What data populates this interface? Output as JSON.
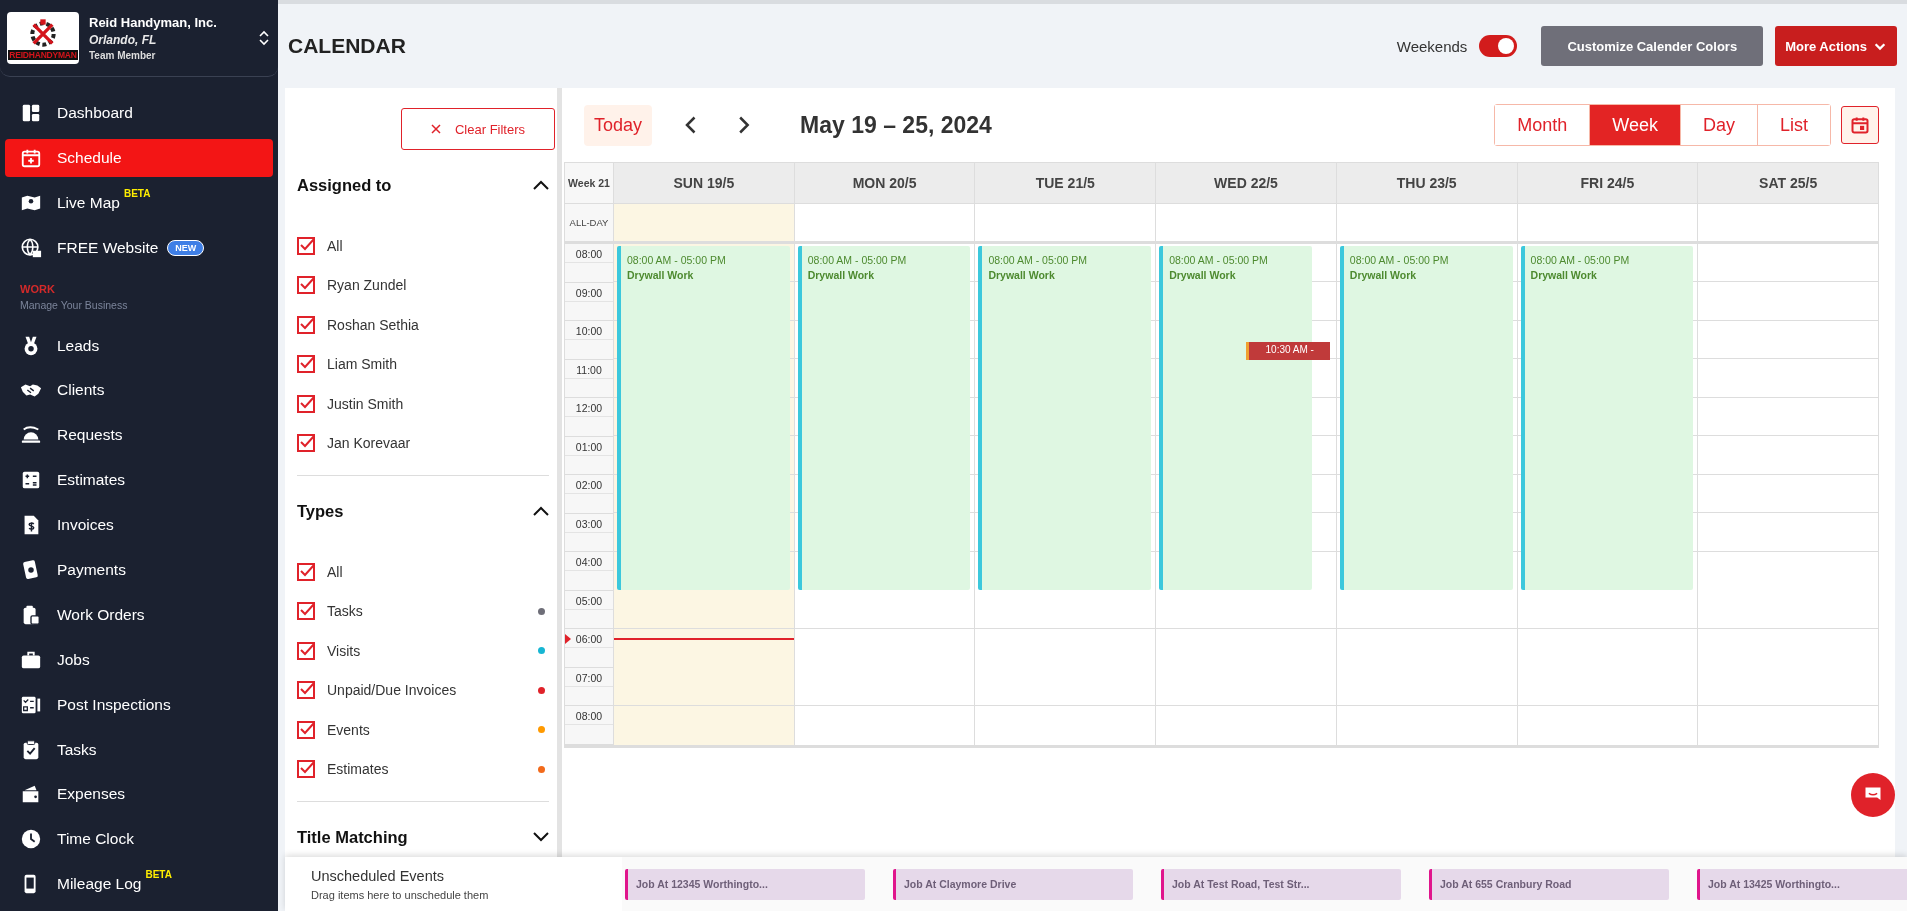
{
  "company": {
    "name": "Reid Handyman, Inc.",
    "location": "Orlando, FL",
    "role": "Team Member",
    "logo_text": "REIDHANDYMAN"
  },
  "sidebar": {
    "items": [
      {
        "label": "Dashboard",
        "selected": false
      },
      {
        "label": "Schedule",
        "selected": true
      },
      {
        "label": "Live Map",
        "selected": false,
        "badge": {
          "text": "BETA",
          "kind": "superscript"
        }
      },
      {
        "label": "FREE Website",
        "selected": false,
        "badge": {
          "text": "NEW",
          "kind": "pill"
        }
      }
    ],
    "section": {
      "title": "WORK",
      "subtitle": "Manage Your Business"
    },
    "work_items": [
      {
        "label": "Leads",
        "selected": false
      },
      {
        "label": "Clients",
        "selected": false
      },
      {
        "label": "Requests",
        "selected": false
      },
      {
        "label": "Estimates",
        "selected": false
      },
      {
        "label": "Invoices",
        "selected": false
      },
      {
        "label": "Payments",
        "selected": false
      },
      {
        "label": "Work Orders",
        "selected": false
      },
      {
        "label": "Jobs",
        "selected": false
      },
      {
        "label": "Post Inspections",
        "selected": false
      },
      {
        "label": "Tasks",
        "selected": false
      },
      {
        "label": "Expenses",
        "selected": false
      },
      {
        "label": "Time Clock",
        "selected": false
      },
      {
        "label": "Mileage Log",
        "selected": false,
        "badge": {
          "text": "BETA",
          "kind": "superscript"
        }
      }
    ]
  },
  "page": {
    "title": "CALENDAR",
    "weekends": {
      "label": "Weekends",
      "on": true
    },
    "buttons": [
      {
        "label": "Customize Calender Colors",
        "kind": "secondary"
      },
      {
        "label": "More Actions",
        "kind": "primary"
      }
    ]
  },
  "filters": {
    "clear": "Clear Filters",
    "sections": [
      {
        "title": "Assigned to",
        "expanded": true,
        "items": [
          {
            "label": "All",
            "checked": true
          },
          {
            "label": "Ryan Zundel",
            "checked": true
          },
          {
            "label": "Roshan Sethia",
            "checked": true
          },
          {
            "label": "Liam Smith",
            "checked": true
          },
          {
            "label": "Justin Smith",
            "checked": true
          },
          {
            "label": "Jan Korevaar",
            "checked": true
          }
        ]
      },
      {
        "title": "Types",
        "expanded": true,
        "items": [
          {
            "label": "All",
            "checked": true
          },
          {
            "label": "Tasks",
            "checked": true,
            "color": "#6e6e78"
          },
          {
            "label": "Visits",
            "checked": true,
            "color": "#17b6d3"
          },
          {
            "label": "Unpaid/Due Invoices",
            "checked": true,
            "color": "#e0222a"
          },
          {
            "label": "Events",
            "checked": true,
            "color": "#ff9a00"
          },
          {
            "label": "Estimates",
            "checked": true,
            "color": "#f26a1b"
          }
        ]
      },
      {
        "title": "Title Matching",
        "expanded": false
      }
    ]
  },
  "calendar": {
    "today": "Today",
    "range": "May 19 – 25, 2024",
    "views": [
      {
        "label": "Month",
        "selected": false
      },
      {
        "label": "Week",
        "selected": true
      },
      {
        "label": "Day",
        "selected": false
      },
      {
        "label": "List",
        "selected": false
      }
    ],
    "week_label": "Week 21",
    "allday_label": "ALL-DAY",
    "days": [
      {
        "label": "SUN 19/5",
        "today": true,
        "events": [
          {
            "kind": "job",
            "time": "08:00 AM - 05:00 PM",
            "title": "Drywall Work"
          }
        ]
      },
      {
        "label": "MON 20/5",
        "today": false,
        "events": [
          {
            "kind": "job",
            "time": "08:00 AM - 05:00 PM",
            "title": "Drywall Work"
          }
        ]
      },
      {
        "label": "TUE 21/5",
        "today": false,
        "events": [
          {
            "kind": "job",
            "time": "08:00 AM - 05:00 PM",
            "title": "Drywall Work"
          }
        ]
      },
      {
        "label": "WED 22/5",
        "today": false,
        "events": [
          {
            "kind": "job",
            "time": "08:00 AM - 05:00 PM",
            "title": "Drywall Work"
          },
          {
            "kind": "event",
            "time": "10:30 AM -"
          }
        ]
      },
      {
        "label": "THU 23/5",
        "today": false,
        "events": [
          {
            "kind": "job",
            "time": "08:00 AM - 05:00 PM",
            "title": "Drywall Work"
          }
        ]
      },
      {
        "label": "FRI 24/5",
        "today": false,
        "events": [
          {
            "kind": "job",
            "time": "08:00 AM - 05:00 PM",
            "title": "Drywall Work"
          }
        ]
      },
      {
        "label": "SAT 25/5",
        "today": false
      }
    ],
    "hours": [
      {
        "label": "08:00",
        "now": false
      },
      {
        "label": "09:00",
        "now": false
      },
      {
        "label": "10:00",
        "now": false
      },
      {
        "label": "11:00",
        "now": false
      },
      {
        "label": "12:00",
        "now": false
      },
      {
        "label": "01:00",
        "now": false
      },
      {
        "label": "02:00",
        "now": false
      },
      {
        "label": "03:00",
        "now": false
      },
      {
        "label": "04:00",
        "now": false
      },
      {
        "label": "05:00",
        "now": false
      },
      {
        "label": "06:00",
        "now": true
      },
      {
        "label": "07:00",
        "now": false
      },
      {
        "label": "08:00",
        "now": false
      }
    ]
  },
  "unscheduled": {
    "title": "Unscheduled Events",
    "hint": "Drag items here to unschedule them",
    "items": [
      "Job At 12345 Worthingto...",
      "Job At Claymore Drive",
      "Job At Test Road, Test Str...",
      "Job At 655 Cranbury Road",
      "Job At 13425 Worthingto..."
    ]
  }
}
